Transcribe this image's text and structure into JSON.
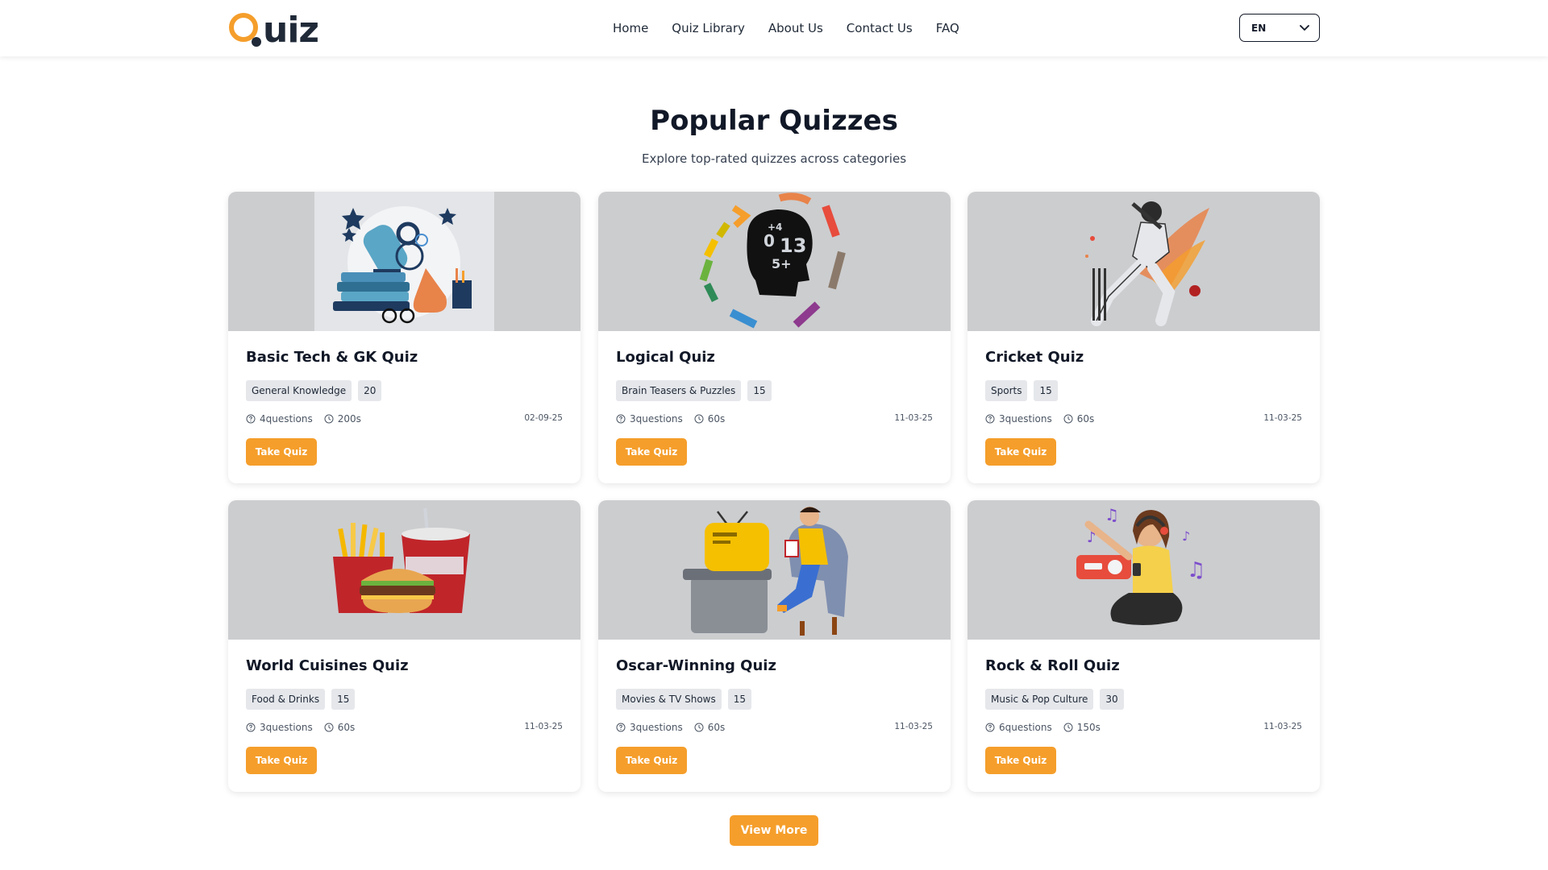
{
  "header": {
    "logo_text": "uiz",
    "nav": [
      "Home",
      "Quiz Library",
      "About Us",
      "Contact Us",
      "FAQ"
    ],
    "language": "EN"
  },
  "section": {
    "title": "Popular Quizzes",
    "subtitle": "Explore top-rated quizzes across categories"
  },
  "quizzes": [
    {
      "title": "Basic Tech & GK Quiz",
      "category": "General Knowledge",
      "count": "20",
      "questions": "4questions",
      "time": "200s",
      "date": "02-09-25",
      "button": "Take Quiz",
      "image": "science-lab-illustration"
    },
    {
      "title": "Logical Quiz",
      "category": "Brain Teasers & Puzzles",
      "count": "15",
      "questions": "3questions",
      "time": "60s",
      "date": "11-03-25",
      "button": "Take Quiz",
      "image": "head-numbers-illustration"
    },
    {
      "title": "Cricket Quiz",
      "category": "Sports",
      "count": "15",
      "questions": "3questions",
      "time": "60s",
      "date": "11-03-25",
      "button": "Take Quiz",
      "image": "cricket-player-illustration"
    },
    {
      "title": "World Cuisines Quiz",
      "category": "Food & Drinks",
      "count": "15",
      "questions": "3questions",
      "time": "60s",
      "date": "11-03-25",
      "button": "Take Quiz",
      "image": "fast-food-illustration"
    },
    {
      "title": "Oscar-Winning Quiz",
      "category": "Movies & TV Shows",
      "count": "15",
      "questions": "3questions",
      "time": "60s",
      "date": "11-03-25",
      "button": "Take Quiz",
      "image": "tv-watcher-illustration"
    },
    {
      "title": "Rock & Roll Quiz",
      "category": "Music & Pop Culture",
      "count": "30",
      "questions": "6questions",
      "time": "150s",
      "date": "11-03-25",
      "button": "Take Quiz",
      "image": "music-listener-illustration"
    }
  ],
  "view_more": "View More",
  "colors": {
    "accent": "#f59e2b",
    "image_bg": "#cccdcf",
    "tag_bg": "#e5e7eb"
  }
}
